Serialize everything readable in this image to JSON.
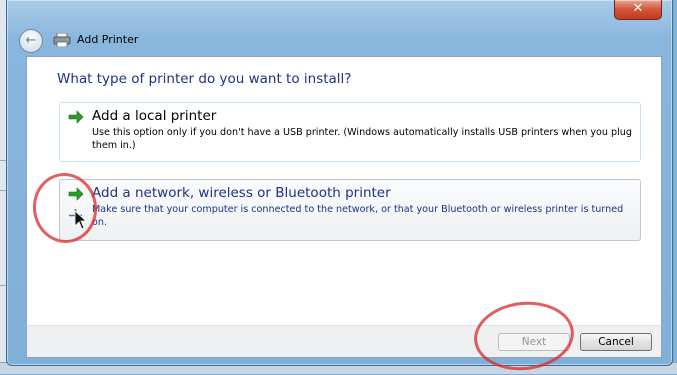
{
  "window": {
    "title": "Add Printer",
    "close_label": "✕",
    "back_label": "←"
  },
  "dialog": {
    "heading": "What type of printer do you want to install?",
    "options": [
      {
        "title": "Add a local printer",
        "description": "Use this option only if you don't have a USB printer. (Windows automatically installs USB printers when you plug them in.)"
      },
      {
        "title": "Add a network, wireless or Bluetooth printer",
        "description": "Make sure that your computer is connected to the network, or that your Bluetooth or wireless printer is turned on."
      }
    ]
  },
  "footer": {
    "next_label": "Next",
    "cancel_label": "Cancel"
  },
  "colors": {
    "heading_blue": "#1e3287",
    "arrow_green": "#2a9a2a",
    "annotation_red": "#dc2828",
    "close_red": "#c4381d"
  },
  "icons": [
    "back-arrow-icon",
    "printer-icon",
    "green-arrow-icon",
    "mouse-cursor-icon",
    "close-icon"
  ]
}
